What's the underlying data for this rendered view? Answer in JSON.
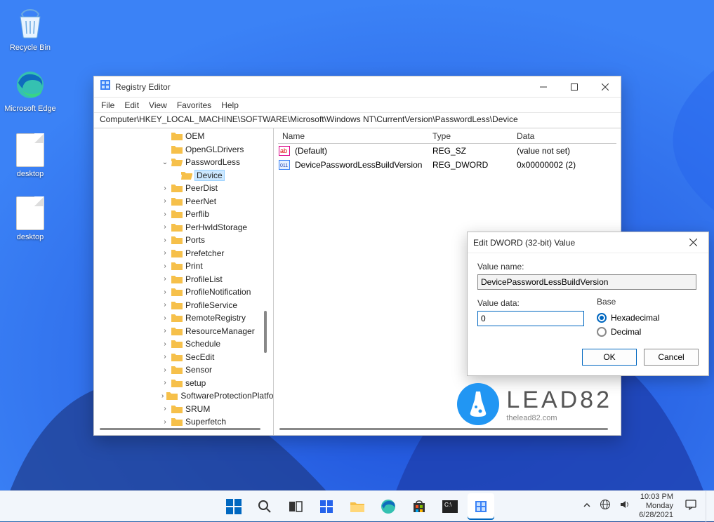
{
  "desktop": {
    "recycle": "Recycle Bin",
    "edge": "Microsoft Edge",
    "file1": "desktop",
    "file2": "desktop"
  },
  "window": {
    "title": "Registry Editor",
    "menu": [
      "File",
      "Edit",
      "View",
      "Favorites",
      "Help"
    ],
    "address": "Computer\\HKEY_LOCAL_MACHINE\\SOFTWARE\\Microsoft\\Windows NT\\CurrentVersion\\PasswordLess\\Device",
    "tree": [
      {
        "label": "OEM",
        "depth": 6,
        "exp": ""
      },
      {
        "label": "OpenGLDrivers",
        "depth": 6,
        "exp": ""
      },
      {
        "label": "PasswordLess",
        "depth": 6,
        "exp": "v",
        "open": true
      },
      {
        "label": "Device",
        "depth": 7,
        "exp": "",
        "sel": true
      },
      {
        "label": "PeerDist",
        "depth": 6,
        "exp": ">"
      },
      {
        "label": "PeerNet",
        "depth": 6,
        "exp": ">"
      },
      {
        "label": "Perflib",
        "depth": 6,
        "exp": ">"
      },
      {
        "label": "PerHwIdStorage",
        "depth": 6,
        "exp": ">"
      },
      {
        "label": "Ports",
        "depth": 6,
        "exp": ">"
      },
      {
        "label": "Prefetcher",
        "depth": 6,
        "exp": ">"
      },
      {
        "label": "Print",
        "depth": 6,
        "exp": ">"
      },
      {
        "label": "ProfileList",
        "depth": 6,
        "exp": ">"
      },
      {
        "label": "ProfileNotification",
        "depth": 6,
        "exp": ">"
      },
      {
        "label": "ProfileService",
        "depth": 6,
        "exp": ">"
      },
      {
        "label": "RemoteRegistry",
        "depth": 6,
        "exp": ">"
      },
      {
        "label": "ResourceManager",
        "depth": 6,
        "exp": ">"
      },
      {
        "label": "Schedule",
        "depth": 6,
        "exp": ">"
      },
      {
        "label": "SecEdit",
        "depth": 6,
        "exp": ">"
      },
      {
        "label": "Sensor",
        "depth": 6,
        "exp": ">"
      },
      {
        "label": "setup",
        "depth": 6,
        "exp": ">"
      },
      {
        "label": "SoftwareProtectionPlatform",
        "depth": 6,
        "exp": ">"
      },
      {
        "label": "SRUM",
        "depth": 6,
        "exp": ">"
      },
      {
        "label": "Superfetch",
        "depth": 6,
        "exp": ">"
      }
    ],
    "cols": {
      "name": "Name",
      "type": "Type",
      "data": "Data"
    },
    "rows": [
      {
        "name": "(Default)",
        "type": "REG_SZ",
        "data": "(value not set)",
        "icon": "ab"
      },
      {
        "name": "DevicePasswordLessBuildVersion",
        "type": "REG_DWORD",
        "data": "0x00000002 (2)",
        "icon": "bin"
      }
    ]
  },
  "modal": {
    "title": "Edit DWORD (32-bit) Value",
    "valueNameLabel": "Value name:",
    "valueName": "DevicePasswordLessBuildVersion",
    "valueDataLabel": "Value data:",
    "valueData": "0",
    "baseLabel": "Base",
    "hex": "Hexadecimal",
    "dec": "Decimal",
    "ok": "OK",
    "cancel": "Cancel"
  },
  "watermark": {
    "l1": "LEAD82",
    "l2": "thelead82.com"
  },
  "taskbar": {
    "time": "10:03 PM",
    "day": "Monday",
    "date": "6/28/2021"
  }
}
